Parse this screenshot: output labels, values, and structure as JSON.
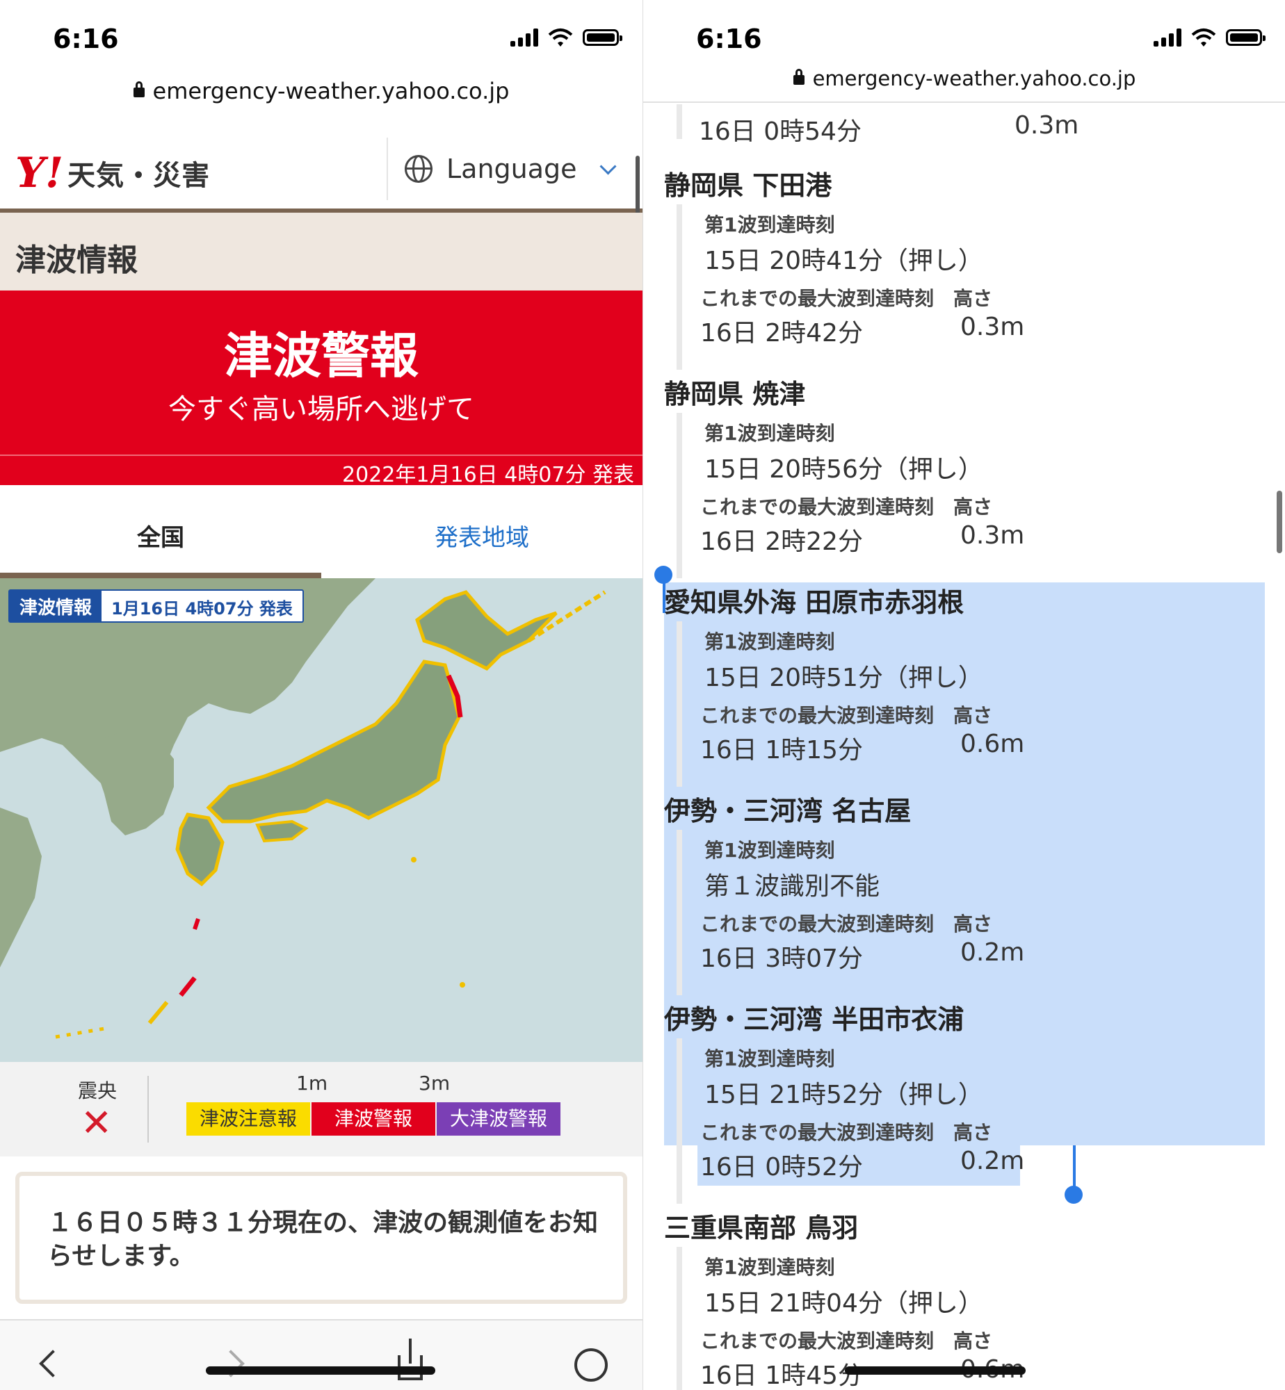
{
  "status": {
    "time": "6:16"
  },
  "url": "emergency-weather.yahoo.co.jp",
  "left": {
    "logo_y": "Y!",
    "logo_text": "天気・災害",
    "language_label": "Language",
    "section_title": "津波情報",
    "warning": {
      "headline": "津波警報",
      "subline": "今すぐ高い場所へ逃げて",
      "issued": "2022年1月16日 4時07分 発表"
    },
    "tabs": {
      "national": "全国",
      "regions": "発表地域"
    },
    "map_label": {
      "tag": "津波情報",
      "date": "1月16日 4時07分 発表"
    },
    "legend": {
      "epicenter": "震央",
      "epicenter_mark": "✕",
      "tick1": "1m",
      "tick2": "3m",
      "advisory": "津波注意報",
      "warning": "津波警報",
      "major": "大津波警報"
    },
    "notice": "１６日０５時３１分現在の、津波の観測値をお知らせします。"
  },
  "right": {
    "top_row": {
      "time": "16日 0時54分",
      "height": "0.3m"
    },
    "labels": {
      "first_wave": "第1波到達時刻",
      "max_wave": "これまでの最大波到達時刻",
      "height": "高さ"
    },
    "stations": [
      {
        "name": "静岡県 下田港",
        "first": "15日 20時41分（押し）",
        "max_time": "16日 2時42分",
        "height": "0.3m"
      },
      {
        "name": "静岡県 焼津",
        "first": "15日 20時56分（押し）",
        "max_time": "16日 2時22分",
        "height": "0.3m"
      },
      {
        "name": "愛知県外海 田原市赤羽根",
        "first": "15日 20時51分（押し）",
        "max_time": "16日 1時15分",
        "height": "0.6m"
      },
      {
        "name": "伊勢・三河湾 名古屋",
        "first": "第１波識別不能",
        "max_time": "16日 3時07分",
        "height": "0.2m"
      },
      {
        "name": "伊勢・三河湾 半田市衣浦",
        "first": "15日 21時52分（押し）",
        "max_time": "16日 0時52分",
        "height": "0.2m"
      },
      {
        "name": "三重県南部 鳥羽",
        "first": "15日 21時04分（押し）",
        "max_time": "16日 1時45分",
        "height": "0.6m"
      }
    ]
  },
  "colors": {
    "warning_red": "#e1001c",
    "advisory_yellow": "#fadc00",
    "major_purple": "#7b3fb5",
    "selection_blue": "#2a7ae4"
  }
}
